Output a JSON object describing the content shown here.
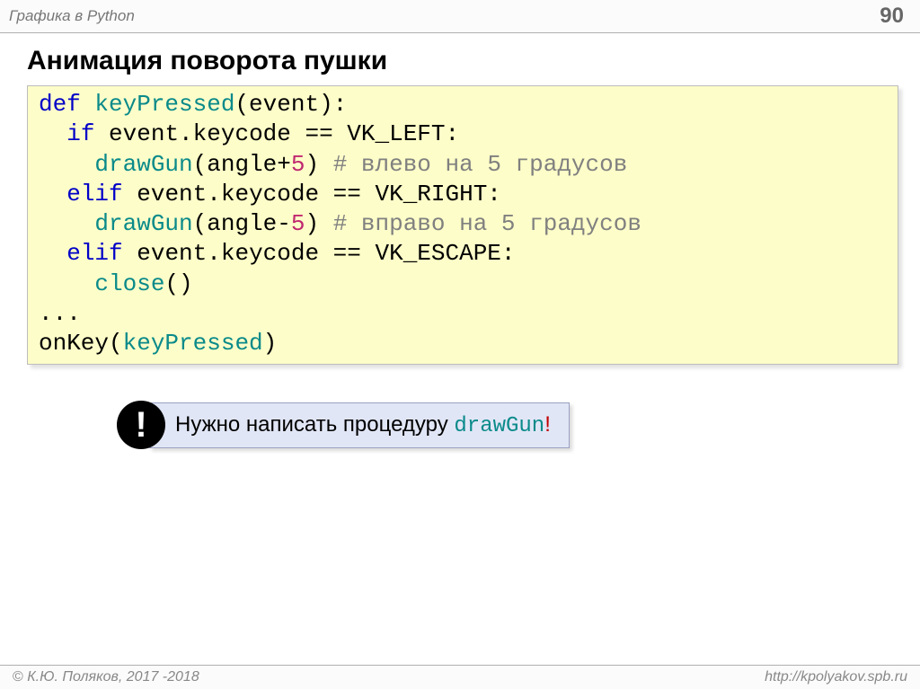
{
  "header": {
    "left": "Графика в Python",
    "page": "90"
  },
  "title": "Анимация поворота пушки",
  "code": {
    "l1_def": "def ",
    "l1_fn": "keyPressed",
    "l1_rest": "(event):",
    "l2_a": "  ",
    "l2_if": "if",
    "l2_b": " event.keycode == VK_LEFT:",
    "l3_a": "    ",
    "l3_fn": "drawGun",
    "l3_b": "(angle+",
    "l3_num": "5",
    "l3_c": ") ",
    "l3_cmt": "# влево на 5 градусов",
    "l4_a": "  ",
    "l4_elif": "elif",
    "l4_b": " event.keycode == VK_RIGHT:",
    "l5_a": "    ",
    "l5_fn": "drawGun",
    "l5_b": "(angle-",
    "l5_num": "5",
    "l5_c": ") ",
    "l5_cmt": "# вправо на 5 градусов",
    "l6_a": "  ",
    "l6_elif": "elif",
    "l6_b": " event.keycode == VK_ESCAPE:",
    "l7_a": "    ",
    "l7_fn": "close",
    "l7_b": "()",
    "l8": "...",
    "l9_a": "onKey(",
    "l9_fn": "keyPressed",
    "l9_b": ")"
  },
  "callout": {
    "badge": "!",
    "text_a": "Нужно написать процедуру ",
    "text_fn": "drawGun",
    "text_excl": "!"
  },
  "footer": {
    "copy": "© ",
    "author": "К.Ю. Поляков, 2017 -2018",
    "url": "http://kpolyakov.spb.ru"
  }
}
